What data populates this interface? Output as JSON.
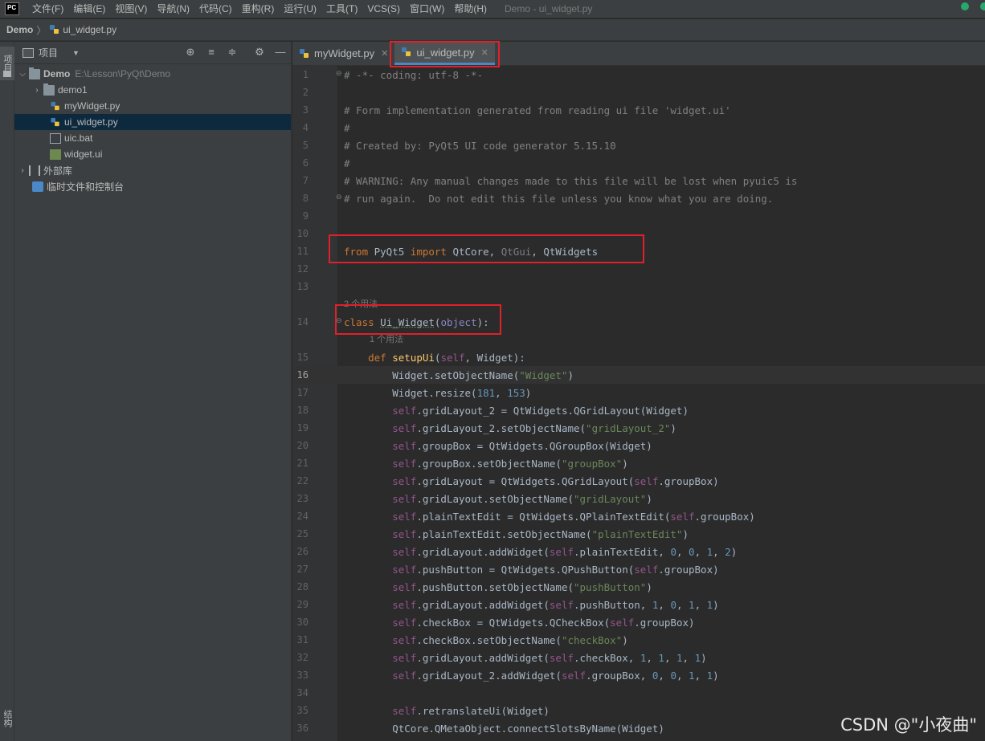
{
  "menubar": {
    "logo": "PC",
    "items": [
      "文件(F)",
      "编辑(E)",
      "视图(V)",
      "导航(N)",
      "代码(C)",
      "重构(R)",
      "运行(U)",
      "工具(T)",
      "VCS(S)",
      "窗口(W)",
      "帮助(H)"
    ],
    "window_title": "Demo - ui_widget.py"
  },
  "breadcrumb": {
    "root": "Demo",
    "file": "ui_widget.py"
  },
  "toolstrip": {
    "top_label": "项目",
    "bottom_label": "结构"
  },
  "project_panel": {
    "title": "项目",
    "tree": [
      {
        "label": "Demo",
        "path": "E:\\Lesson\\PyQt\\Demo"
      },
      {
        "label": "demo1"
      },
      {
        "label": "myWidget.py"
      },
      {
        "label": "ui_widget.py"
      },
      {
        "label": "uic.bat"
      },
      {
        "label": "widget.ui"
      },
      {
        "label": "外部库"
      },
      {
        "label": "临时文件和控制台"
      }
    ]
  },
  "editor": {
    "tabs": [
      {
        "label": "myWidget.py",
        "active": false
      },
      {
        "label": "ui_widget.py",
        "active": true
      }
    ],
    "current_line": 16,
    "usage_hints": [
      "2 个用法",
      "1 个用法"
    ]
  },
  "watermark": "CSDN @\"小夜曲\"",
  "colors": {
    "annotation": "#e0202a",
    "keyword": "#cc7832",
    "string": "#6a8759",
    "number": "#6897bb",
    "self": "#94558d",
    "comment": "#808080"
  }
}
